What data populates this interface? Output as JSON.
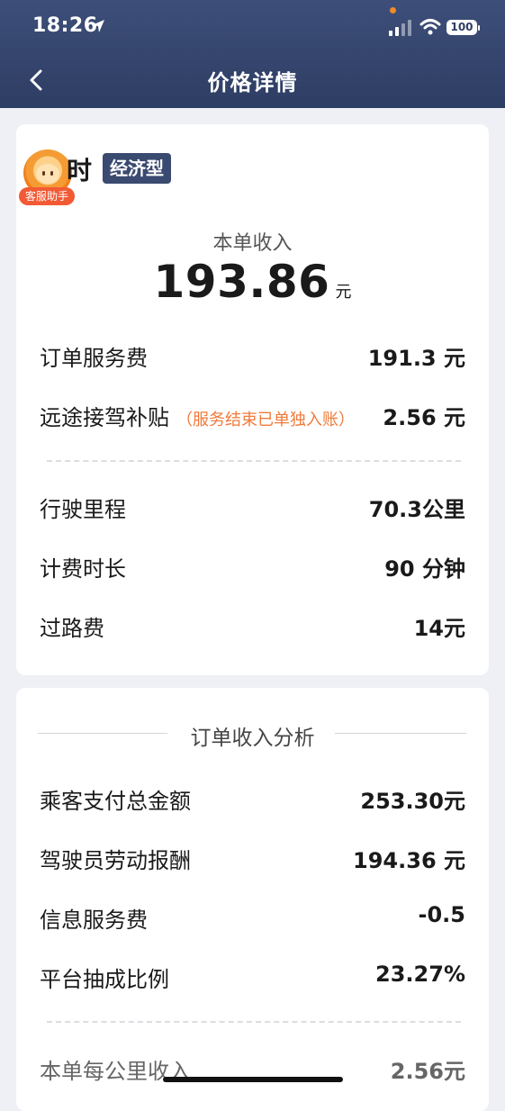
{
  "status_bar": {
    "time": "18:26",
    "battery": "100"
  },
  "header": {
    "title": "价格详情"
  },
  "driver": {
    "name": "时",
    "car_type": "经济型",
    "helper_badge": "客服助手"
  },
  "income": {
    "label": "本单收入",
    "value": "193.86",
    "unit": "元"
  },
  "fees": [
    {
      "label": "订单服务费",
      "value": "191.3 元",
      "note": ""
    },
    {
      "label": "远途接驾补贴",
      "value": "2.56 元",
      "note": "（服务结束已单独入账）"
    }
  ],
  "trip": [
    {
      "label": "行驶里程",
      "value": "70.3公里"
    },
    {
      "label": "计费时长",
      "value": "90 分钟"
    },
    {
      "label": "过路费",
      "value": "14元"
    }
  ],
  "analysis": {
    "title": "订单收入分析",
    "rows": [
      {
        "label": "乘客支付总金额",
        "value": "253.30元"
      },
      {
        "label": "驾驶员劳动报酬",
        "value": "194.36 元"
      },
      {
        "label": "信息服务费",
        "value": "-0.5"
      },
      {
        "label": "平台抽成比例",
        "value": "23.27%"
      }
    ],
    "per_km": {
      "label": "本单每公里收入",
      "value": "2.56元"
    }
  },
  "colors": {
    "header": "#2e3d63",
    "accent_orange": "#f07a3a",
    "badge_red": "#f25a35"
  },
  "icons": {
    "back": "chevron-left-icon",
    "location": "location-arrow-icon",
    "signal": "cellular-signal-icon",
    "wifi": "wifi-icon",
    "battery": "battery-icon"
  }
}
